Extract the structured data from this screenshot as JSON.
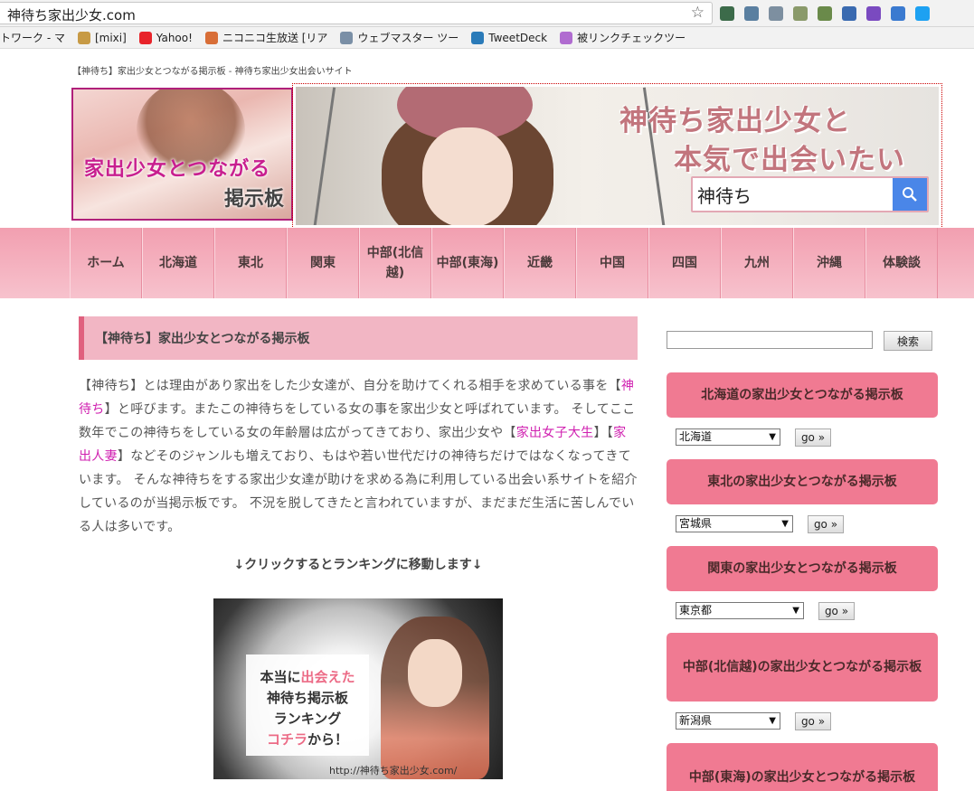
{
  "browser": {
    "url": "神待ち家出少女.com",
    "bookmarks": [
      {
        "label": "トワーク - マ",
        "color": "#dddddd"
      },
      {
        "label": "[mixi]",
        "color": "#c79a45"
      },
      {
        "label": "Yahoo!",
        "color": "#e8232a"
      },
      {
        "label": "ニコニコ生放送 [リア",
        "color": "#d86e37"
      },
      {
        "label": "ウェブマスター ツー",
        "color": "#7a8fa6"
      },
      {
        "label": "TweetDeck",
        "color": "#2b7bb9"
      },
      {
        "label": "被リンクチェックツー",
        "color": "#b06cd0"
      }
    ],
    "extension_icons": [
      "globe-icon",
      "chain-icon",
      "dropbox-icon",
      "y-icon",
      "puzzle-icon",
      "chat-icon",
      "f-icon",
      "db-icon",
      "twitter-icon"
    ],
    "extension_colors": [
      "#3c6b4a",
      "#5a7fa0",
      "#7d8fa0",
      "#8a9a6a",
      "#6a8a4a",
      "#3a6ab0",
      "#7a4ac0",
      "#3a7ad0",
      "#1da1f2"
    ]
  },
  "header": {
    "tagline": "【神待ち】家出少女とつながる掲示板 - 神待ち家出少女出会いサイト",
    "logo": {
      "line1": "家出少女とつながる",
      "line2": "掲示板"
    },
    "banner": {
      "title1": "神待ち家出少女と",
      "title2": "本気で出会いたい",
      "search_value": "神待ち"
    }
  },
  "nav": {
    "items": [
      {
        "label": "ホーム"
      },
      {
        "label": "北海道"
      },
      {
        "label": "東北"
      },
      {
        "label": "関東"
      },
      {
        "label": "中部(北信越)"
      },
      {
        "label": "中部(東海)"
      },
      {
        "label": "近畿"
      },
      {
        "label": "中国"
      },
      {
        "label": "四国"
      },
      {
        "label": "九州"
      },
      {
        "label": "沖縄"
      },
      {
        "label": "体験談"
      }
    ]
  },
  "main": {
    "entry_title": "【神待ち】家出少女とつながる掲示板",
    "intro": {
      "p1": "【神待ち】とは理由があり家出をした少女達が、自分を助けてくれる相手を求めている事を【",
      "link1": "神待ち",
      "p2": "】と呼びます。またこの神待ちをしている女の事を家出少女と呼ばれています。 そしてここ数年でこの神待ちをしている女の年齢層は広がってきており、家出少女や【",
      "link2": "家出女子大生",
      "p3": "】【",
      "link3": "家出人妻",
      "p4": "】などそのジャンルも増えており、もはや若い世代だけの神待ちだけではなくなってきています。 そんな神待ちをする家出少女達が助けを求める為に利用している出会い系サイトを紹介しているのが当掲示板です。 不況を脱してきたと言われていますが、まだまだ生活に苦しんでいる人は多いです。"
    },
    "cta": "↓クリックするとランキングに移動します↓",
    "rank_banner": {
      "line1a": "本当に",
      "line1b": "出会えた",
      "line2": "神待ち掲示板",
      "line3": "ランキング",
      "line4a": "コチラ",
      "line4b": "から！",
      "url": "http://神待ち家出少女.com/"
    }
  },
  "sidebar": {
    "search_button": "検索",
    "widgets": [
      {
        "title": "北海道の家出少女とつながる掲示板",
        "selected": "北海道",
        "go": "go »"
      },
      {
        "title": "東北の家出少女とつながる掲示板",
        "selected": "宮城県",
        "go": "go »"
      },
      {
        "title": "関東の家出少女とつながる掲示板",
        "selected": "東京都",
        "go": "go »"
      },
      {
        "title": "中部(北信越)の家出少女とつながる掲示板",
        "selected": "新潟県",
        "go": "go »"
      },
      {
        "title": "中部(東海)の家出少女とつながる掲示板"
      }
    ]
  }
}
